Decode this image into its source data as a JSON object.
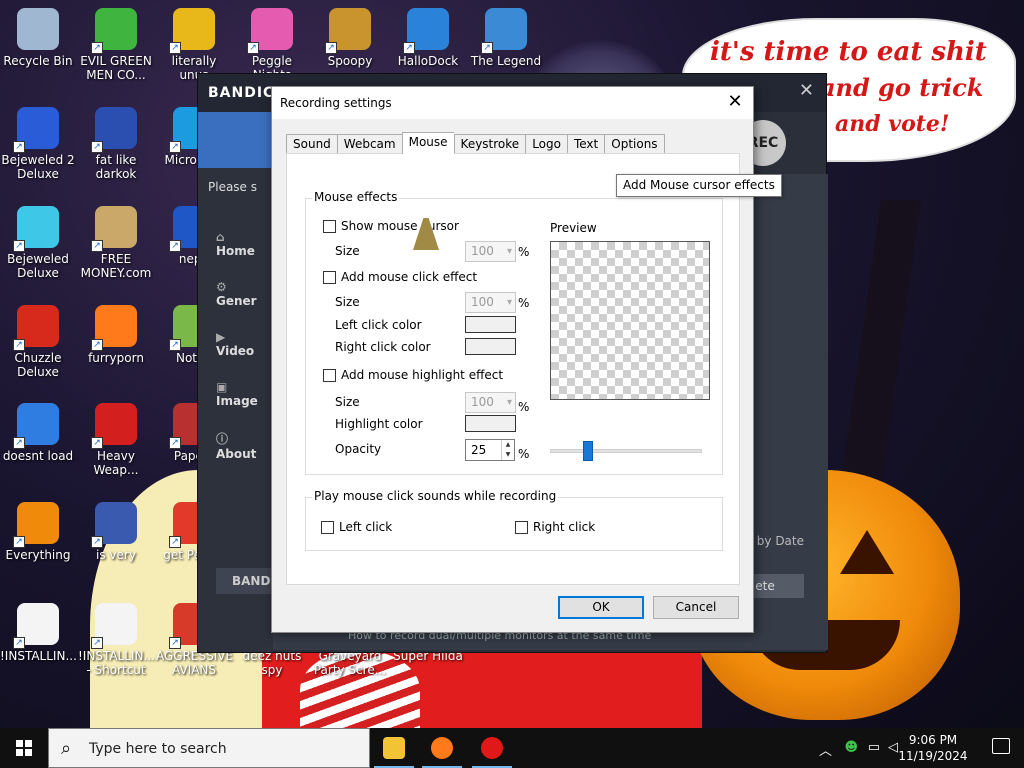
{
  "desktop": {
    "icons": [
      {
        "label": "Recycle Bin",
        "color": "#9fb7d0"
      },
      {
        "label": "EVIL GREEN MEN CO...",
        "color": "#3fb53f"
      },
      {
        "label": "literally unus",
        "color": "#e8b81a"
      },
      {
        "label": "Peggle Nights",
        "color": "#e55bb0"
      },
      {
        "label": "Spoopy",
        "color": "#c9932e"
      },
      {
        "label": "HalloDock",
        "color": "#2b82d9"
      },
      {
        "label": "The Legend",
        "color": "#3a8ad6"
      },
      {
        "label": "Bejeweled 2 Deluxe",
        "color": "#2a5cd8"
      },
      {
        "label": "fat like darkok",
        "color": "#2a4fb0"
      },
      {
        "label": "Micro Edg",
        "color": "#1c9be0"
      },
      {
        "label": "Bejeweled Deluxe",
        "color": "#3fc7e8"
      },
      {
        "label": "FREE MONEY.com",
        "color": "#c9a86a"
      },
      {
        "label": "neph",
        "color": "#1f57c6"
      },
      {
        "label": "Chuzzle Deluxe",
        "color": "#d82a1c"
      },
      {
        "label": "furryporn",
        "color": "#ff7a1a"
      },
      {
        "label": "Notep",
        "color": "#7ab84a"
      },
      {
        "label": "doesnt load",
        "color": "#2f7de0"
      },
      {
        "label": "Heavy Weap...",
        "color": "#d41f1f"
      },
      {
        "label": "Papers",
        "color": "#b83030"
      },
      {
        "label": "Everything",
        "color": "#f08a0a"
      },
      {
        "label": "is very",
        "color": "#3a5ab0"
      },
      {
        "label": "get Pe Del",
        "color": "#e23a2a"
      },
      {
        "label": "!INSTALLIN...",
        "color": "#f4f4f4"
      },
      {
        "label": "!INSTALLIN... - Shortcut",
        "color": "#f4f4f4"
      },
      {
        "label": "AGGRESSIVE AVIANS",
        "color": "#d83a2a"
      },
      {
        "label": "deez nuts spy",
        "color": ""
      },
      {
        "label": "Graveyard Party Scre...",
        "color": ""
      },
      {
        "label": "Super Hilda",
        "color": ""
      }
    ]
  },
  "wallpaper": {
    "speech_lines": [
      "it's time to eat shit",
      "and go trick",
      "and vote!"
    ],
    "speech_color": "#d41818"
  },
  "bandicam": {
    "logo": "BANDIC",
    "please": "Please s",
    "nav": [
      {
        "icon": "home-icon",
        "glyph": "⌂",
        "label": "Home"
      },
      {
        "icon": "gear-icon",
        "glyph": "⚙",
        "label": "Gener"
      },
      {
        "icon": "video-icon",
        "glyph": "▶",
        "label": "Video"
      },
      {
        "icon": "image-icon",
        "glyph": "▣",
        "label": "Image"
      },
      {
        "icon": "info-icon",
        "glyph": "ⓘ",
        "label": "About"
      }
    ],
    "rec_label": "REC",
    "sort_label": "rt by Date",
    "delete_label": "ete",
    "bottom_label": "BAND",
    "tip": "How to record dual/multiple monitors at the same time"
  },
  "dialog": {
    "title": "Recording settings",
    "close_glyph": "✕",
    "tabs": [
      "Sound",
      "Webcam",
      "Mouse",
      "Keystroke",
      "Logo",
      "Text",
      "Options"
    ],
    "active_tab": "Mouse",
    "mouse_effects": {
      "group_title": "Mouse effects",
      "show_cursor": "Show mouse cursor",
      "size_label": "Size",
      "size_value": "100",
      "pct": "%",
      "click_effect": "Add mouse click effect",
      "click_size_value": "100",
      "left_click_color": "Left click color",
      "right_click_color": "Right click color",
      "highlight_effect": "Add mouse highlight effect",
      "highlight_size_value": "100",
      "highlight_color": "Highlight color",
      "opacity_label": "Opacity",
      "opacity_value": "25",
      "opacity_fraction": 0.25,
      "preview_label": "Preview"
    },
    "sounds": {
      "group_title": "Play mouse click sounds while recording",
      "left_click": "Left click",
      "right_click": "Right click"
    },
    "ok_label": "OK",
    "cancel_label": "Cancel",
    "accent": "#0078d7"
  },
  "tooltip": "Add Mouse cursor effects",
  "taskbar": {
    "search_placeholder": "Type here to search",
    "time": "9:06 PM",
    "date": "11/19/2024",
    "apps": [
      {
        "name": "file-explorer",
        "color": "#f2c335"
      },
      {
        "name": "firefox",
        "color": "#ff7a1a"
      },
      {
        "name": "bandicam",
        "color": "#e01818"
      }
    ]
  }
}
